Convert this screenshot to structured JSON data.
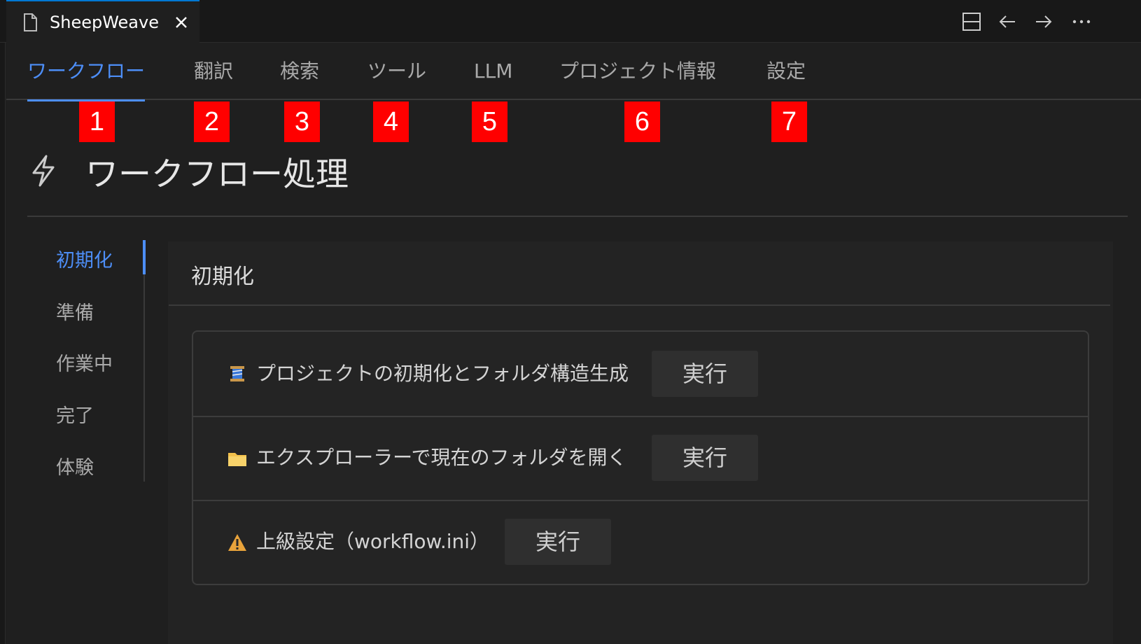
{
  "editor_tab": {
    "label": "SheepWeave",
    "file_icon": "file-icon",
    "close_icon": "close-icon"
  },
  "window_actions": [
    "split-editor-icon",
    "back-arrow-icon",
    "forward-arrow-icon",
    "more-icon"
  ],
  "nav": {
    "tabs": [
      {
        "label": "ワークフロー",
        "active": true
      },
      {
        "label": "翻訳"
      },
      {
        "label": "検索"
      },
      {
        "label": "ツール"
      },
      {
        "label": "LLM"
      },
      {
        "label": "プロジェクト情報"
      },
      {
        "label": "設定"
      }
    ]
  },
  "markers": [
    "1",
    "2",
    "3",
    "4",
    "5",
    "6",
    "7"
  ],
  "page": {
    "title": "ワークフロー処理",
    "icon": "bolt-icon"
  },
  "sidenav": {
    "items": [
      {
        "label": "初期化",
        "active": true
      },
      {
        "label": "準備"
      },
      {
        "label": "作業中"
      },
      {
        "label": "完了"
      },
      {
        "label": "体験"
      }
    ]
  },
  "section": {
    "title": "初期化",
    "actions": [
      {
        "icon": "spool-icon",
        "label": "プロジェクトの初期化とフォルダ構造生成",
        "button": "実行"
      },
      {
        "icon": "folder-icon",
        "label": "エクスプローラーで現在のフォルダを開く",
        "button": "実行"
      },
      {
        "icon": "warning-icon",
        "label": "上級設定（workflow.ini）",
        "button": "実行"
      }
    ]
  },
  "colors": {
    "accent": "#4d8ef7",
    "background": "#1f1f1f",
    "marker": "#ff0000",
    "warning": "#e8a33b",
    "folder": "#f2c04b"
  }
}
